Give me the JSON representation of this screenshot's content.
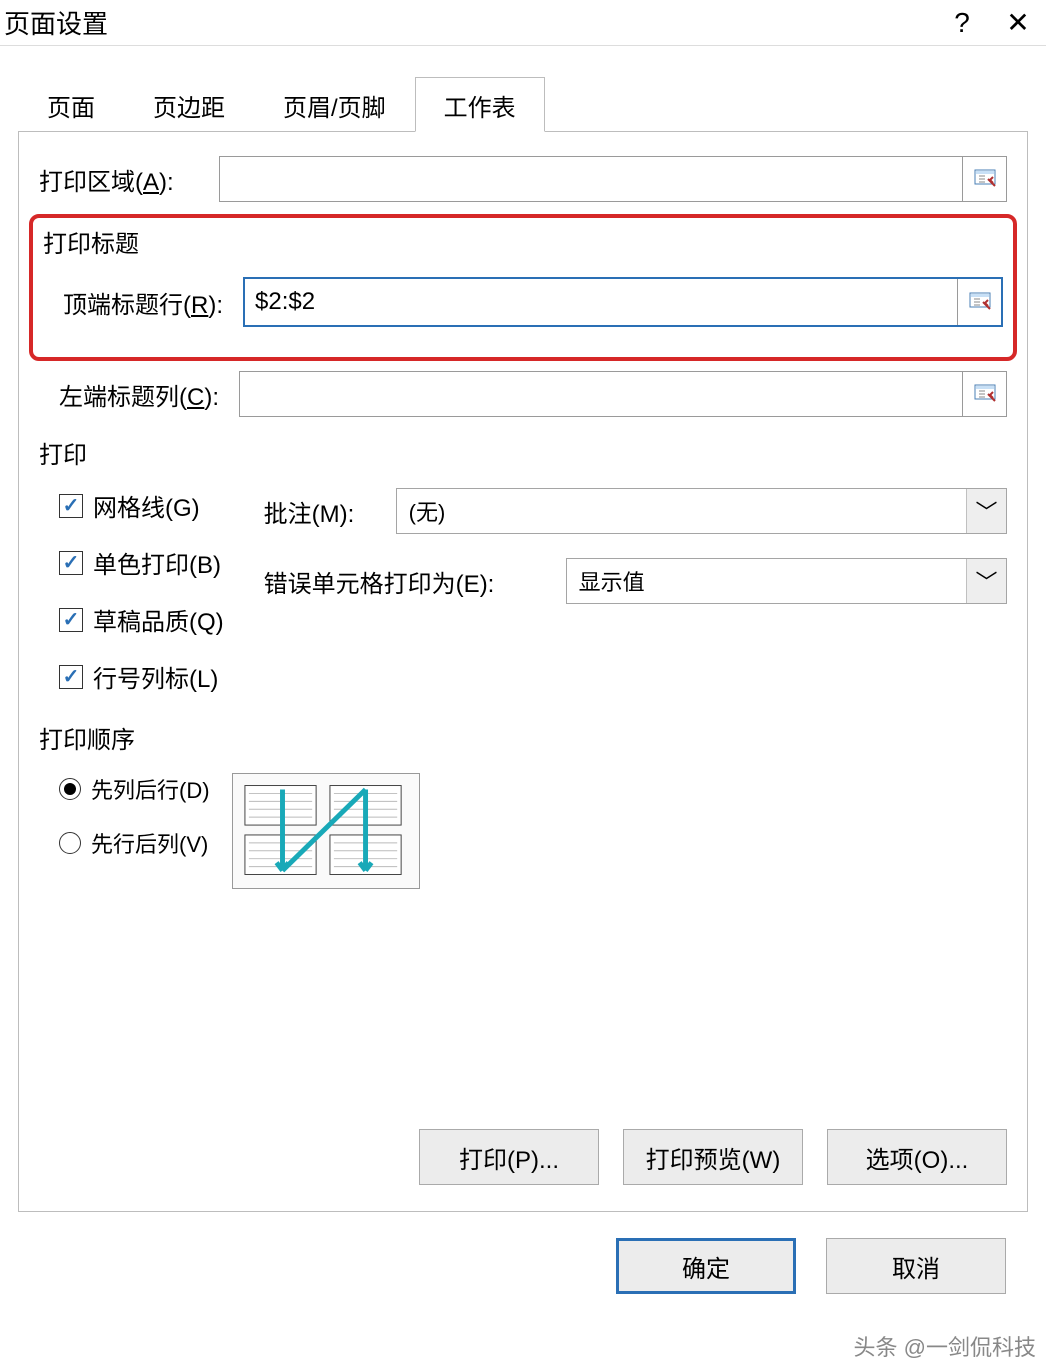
{
  "title": "页面设置",
  "tabs": [
    "页面",
    "页边距",
    "页眉/页脚",
    "工作表"
  ],
  "activeTab": 3,
  "printArea": {
    "label": "打印区域(",
    "shortcut": "A",
    "labelEnd": "):",
    "value": ""
  },
  "printTitles": {
    "section": "打印标题",
    "topRow": {
      "label": "顶端标题行(",
      "shortcut": "R",
      "labelEnd": "):",
      "value": "$2:$2"
    },
    "leftCol": {
      "label": "左端标题列(",
      "shortcut": "C",
      "labelEnd": "):",
      "value": ""
    }
  },
  "print": {
    "section": "打印",
    "checks": [
      {
        "label": "网格线(",
        "shortcut": "G",
        "checked": true
      },
      {
        "label": "单色打印(",
        "shortcut": "B",
        "checked": true
      },
      {
        "label": "草稿品质(",
        "shortcut": "Q",
        "checked": true
      },
      {
        "label": "行号列标(",
        "shortcut": "L",
        "checked": true
      }
    ],
    "comments": {
      "label": "批注(",
      "shortcut": "M",
      "labelEnd": "):",
      "value": "(无)"
    },
    "errors": {
      "label": "错误单元格打印为(",
      "shortcut": "E",
      "labelEnd": "):",
      "value": "显示值"
    }
  },
  "order": {
    "section": "打印顺序",
    "options": [
      {
        "label": "先列后行(",
        "shortcut": "D",
        "selected": true
      },
      {
        "label": "先行后列(",
        "shortcut": "V",
        "selected": false
      }
    ]
  },
  "actions": {
    "print": "打印(P)...",
    "preview": "打印预览(W)",
    "options": "选项(O)..."
  },
  "footer": {
    "ok": "确定",
    "cancel": "取消"
  },
  "watermark": "头条 @一剑侃科技"
}
